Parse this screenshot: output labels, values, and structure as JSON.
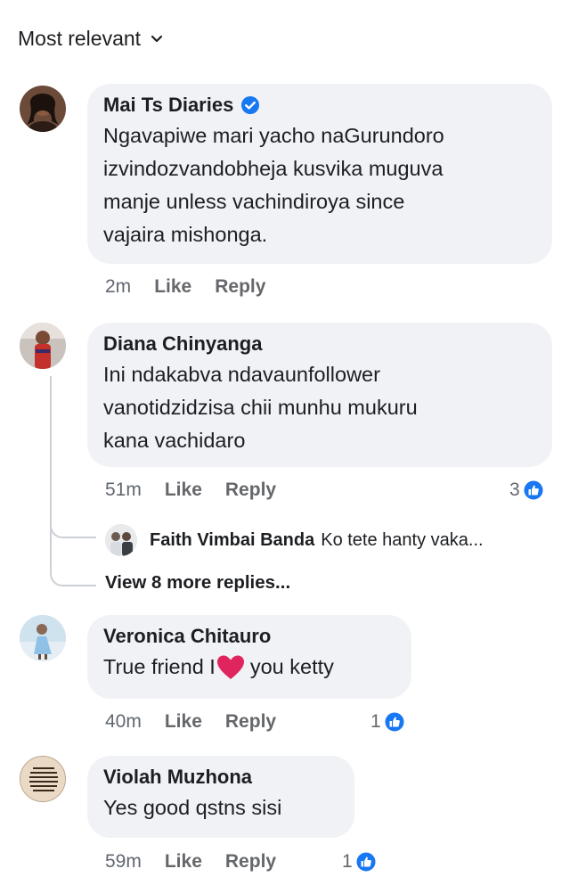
{
  "sort": {
    "label": "Most relevant"
  },
  "comments": [
    {
      "author": "Mai Ts Diaries",
      "verified": true,
      "lines": [
        "Ngavapiwe mari yacho naGurundoro",
        "izvindozvandobheja kusvika muguva",
        "manje unless vachindiroya since",
        "vajaira mishonga."
      ],
      "time": "2m",
      "like": "Like",
      "reply": "Reply"
    },
    {
      "author": "Diana Chinyanga",
      "lines": [
        "Ini ndakabva ndavaunfollower",
        "vanotidzidzisa chii munhu mukuru",
        "kana vachidaro"
      ],
      "time": "51m",
      "like": "Like",
      "reply": "Reply",
      "reactions": "3",
      "replies": {
        "preview_author": "Faith Vimbai Banda",
        "preview_text": "Ko tete hanty vaka...",
        "more": "View 8 more replies..."
      }
    },
    {
      "author": "Veronica Chitauro",
      "text_before": "True friend I",
      "text_after": "you ketty",
      "time": "40m",
      "like": "Like",
      "reply": "Reply",
      "reactions": "1"
    },
    {
      "author": "Violah Muzhona",
      "lines": [
        "Yes good qstns sisi"
      ],
      "time": "59m",
      "like": "Like",
      "reply": "Reply",
      "reactions": "1",
      "avatar_text": "When I say I am blessed I don't mean money or material things. I mean situations that was sent to destroy me but didn't even touch my soul"
    }
  ],
  "colors": {
    "bubble": "#f0f2f5",
    "meta": "#65676b",
    "like_blue": "#1877f2",
    "heart_red": "#e0245e"
  },
  "icons": [
    "chevron-down-icon",
    "verified-badge-icon",
    "like-reaction-icon",
    "heart-emoji-icon"
  ]
}
